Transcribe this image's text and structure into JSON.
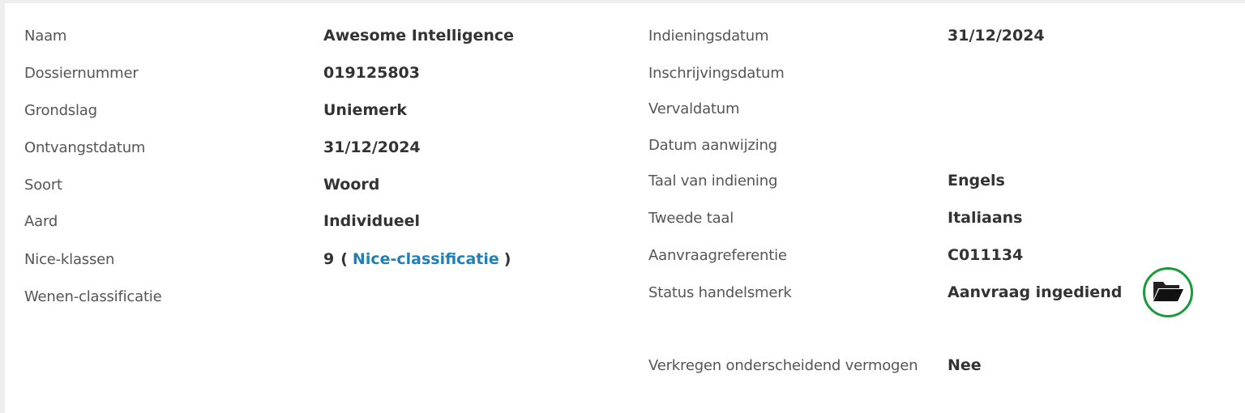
{
  "left": [
    {
      "key": "naam",
      "label": "Naam",
      "value": "Awesome Intelligence"
    },
    {
      "key": "dossiernummer",
      "label": "Dossiernummer",
      "value": "019125803"
    },
    {
      "key": "grondslag",
      "label": "Grondslag",
      "value": "Uniemerk"
    },
    {
      "key": "ontvangstdatum",
      "label": "Ontvangstdatum",
      "value": "31/12/2024"
    },
    {
      "key": "soort",
      "label": "Soort",
      "value": "Woord"
    },
    {
      "key": "aard",
      "label": "Aard",
      "value": "Individueel"
    },
    {
      "key": "nice-klassen",
      "label": "Nice-klassen",
      "value": "9",
      "open": "(",
      "link": "Nice-classificatie",
      "close": ")"
    },
    {
      "key": "wenen",
      "label": "Wenen-classificatie",
      "value": ""
    }
  ],
  "right": [
    {
      "key": "indieningsdatum",
      "label": "Indieningsdatum",
      "value": "31/12/2024"
    },
    {
      "key": "inschrijvingsdatum",
      "label": "Inschrijvingsdatum",
      "value": ""
    },
    {
      "key": "vervaldatum",
      "label": "Vervaldatum",
      "value": ""
    },
    {
      "key": "datum-aanwijzing",
      "label": "Datum aanwijzing",
      "value": ""
    },
    {
      "key": "taal-van-indiening",
      "label": "Taal van indiening",
      "value": "Engels"
    },
    {
      "key": "tweede-taal",
      "label": "Tweede taal",
      "value": "Italiaans"
    },
    {
      "key": "aanvraagreferentie",
      "label": "Aanvraagreferentie",
      "value": "C011134"
    },
    {
      "key": "status-handelsmerk",
      "label": "Status handelsmerk",
      "value": "Aanvraag ingediend"
    },
    {
      "key": "verkregen",
      "label": "Verkregen onderscheidend vermogen",
      "value": "Nee"
    }
  ],
  "icons": {
    "status_action": "folder-open-icon"
  },
  "colors": {
    "link": "#1f7fb8",
    "highlight_ring": "#1a9a3a"
  }
}
